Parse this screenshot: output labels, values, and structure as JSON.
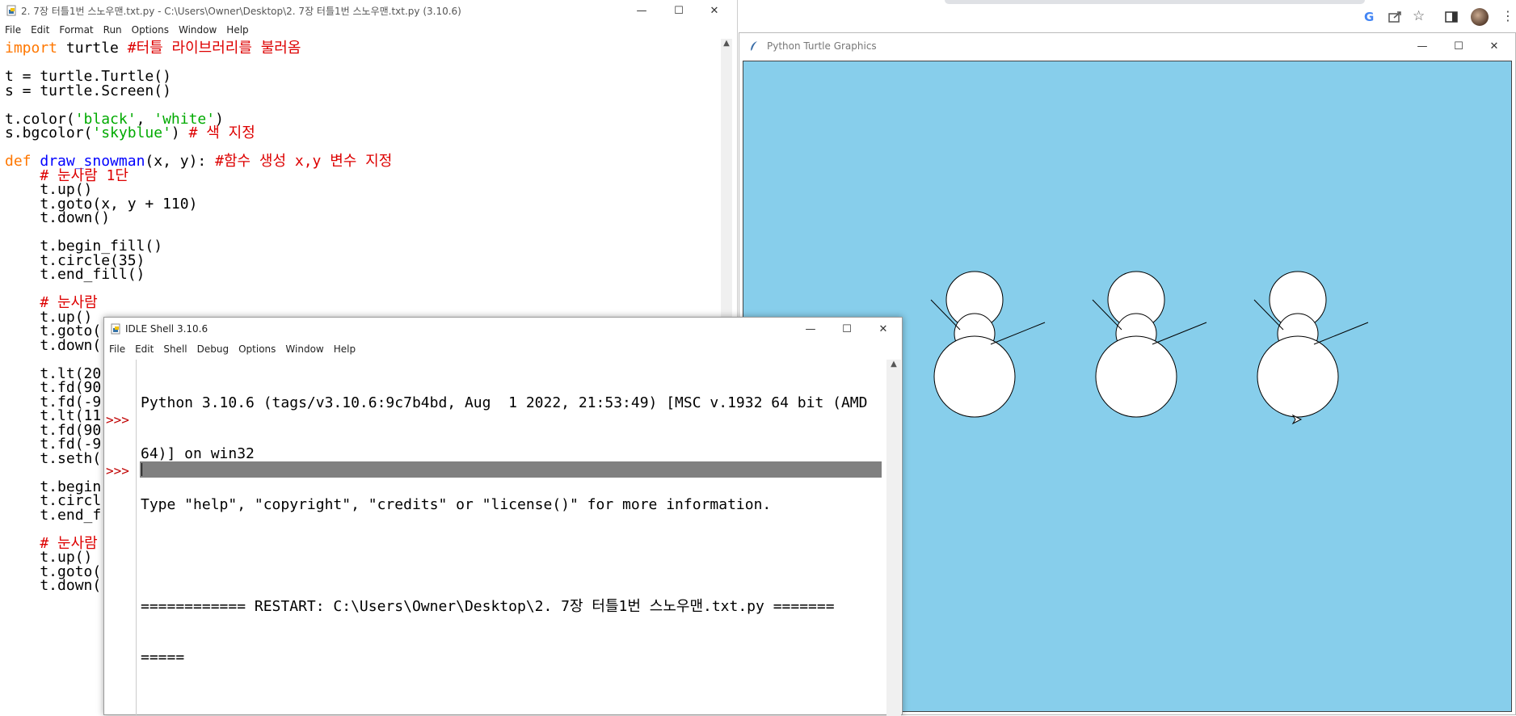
{
  "editor": {
    "title": "2. 7장 터틀1번 스노우맨.txt.py - C:\\Users\\Owner\\Desktop\\2. 7장 터틀1번 스노우맨.txt.py (3.10.6)",
    "menu": [
      "File",
      "Edit",
      "Format",
      "Run",
      "Options",
      "Window",
      "Help"
    ],
    "lines": [
      [
        {
          "t": "import",
          "c": "kw"
        },
        {
          "t": " turtle "
        },
        {
          "t": "#터틀 라이브러리를 불러옴",
          "c": "cm"
        }
      ],
      [],
      [
        {
          "t": "t = turtle.Turtle()"
        }
      ],
      [
        {
          "t": "s = turtle.Screen()"
        }
      ],
      [],
      [
        {
          "t": "t.color("
        },
        {
          "t": "'black'",
          "c": "st"
        },
        {
          "t": ", "
        },
        {
          "t": "'white'",
          "c": "st"
        },
        {
          "t": ")"
        }
      ],
      [
        {
          "t": "s.bgcolor("
        },
        {
          "t": "'skyblue'",
          "c": "st"
        },
        {
          "t": ") "
        },
        {
          "t": "# 색 지정",
          "c": "cm"
        }
      ],
      [],
      [
        {
          "t": "def",
          "c": "kw"
        },
        {
          "t": " "
        },
        {
          "t": "draw_snowman",
          "c": "df"
        },
        {
          "t": "(x, y): "
        },
        {
          "t": "#함수 생성 x,y 변수 지정",
          "c": "cm"
        }
      ],
      [
        {
          "t": "    "
        },
        {
          "t": "# 눈사람 1단",
          "c": "cm"
        }
      ],
      [
        {
          "t": "    t.up()"
        }
      ],
      [
        {
          "t": "    t.goto(x, y + 110)"
        }
      ],
      [
        {
          "t": "    t.down()"
        }
      ],
      [],
      [
        {
          "t": "    t.begin_fill()"
        }
      ],
      [
        {
          "t": "    t.circle(35)"
        }
      ],
      [
        {
          "t": "    t.end_fill()"
        }
      ],
      [],
      [
        {
          "t": "    "
        },
        {
          "t": "# 눈사람",
          "c": "cm"
        }
      ],
      [
        {
          "t": "    t.up()"
        }
      ],
      [
        {
          "t": "    t.goto("
        }
      ],
      [
        {
          "t": "    t.down("
        }
      ],
      [],
      [
        {
          "t": "    t.lt(20"
        }
      ],
      [
        {
          "t": "    t.fd(90"
        }
      ],
      [
        {
          "t": "    t.fd(-9"
        }
      ],
      [
        {
          "t": "    t.lt(11"
        }
      ],
      [
        {
          "t": "    t.fd(90"
        }
      ],
      [
        {
          "t": "    t.fd(-9"
        }
      ],
      [
        {
          "t": "    t.seth("
        }
      ],
      [],
      [
        {
          "t": "    t.begin"
        }
      ],
      [
        {
          "t": "    t.circl"
        }
      ],
      [
        {
          "t": "    t.end_f"
        }
      ],
      [],
      [
        {
          "t": "    "
        },
        {
          "t": "# 눈사람",
          "c": "cm"
        }
      ],
      [
        {
          "t": "    t.up()"
        }
      ],
      [
        {
          "t": "    t.goto("
        }
      ],
      [
        {
          "t": "    t.down("
        }
      ]
    ]
  },
  "shell": {
    "title": "IDLE Shell 3.10.6",
    "menu": [
      "File",
      "Edit",
      "Shell",
      "Debug",
      "Options",
      "Window",
      "Help"
    ],
    "banner1": "Python 3.10.6 (tags/v3.10.6:9c7b4bd, Aug  1 2022, 21:53:49) [MSC v.1932 64 bit (AMD",
    "banner2": "64)] on win32",
    "banner3": "Type \"help\", \"copyright\", \"credits\" or \"license()\" for more information.",
    "restart1": "============ RESTART: C:\\Users\\Owner\\Desktop\\2. 7장 터틀1번 스노우맨.txt.py =======",
    "restart2": "=====",
    "prompt": ">>>"
  },
  "turtle_window": {
    "title": "Python Turtle Graphics",
    "bgcolor": "#87ceeb"
  },
  "browser": {
    "google_letter": "G"
  }
}
